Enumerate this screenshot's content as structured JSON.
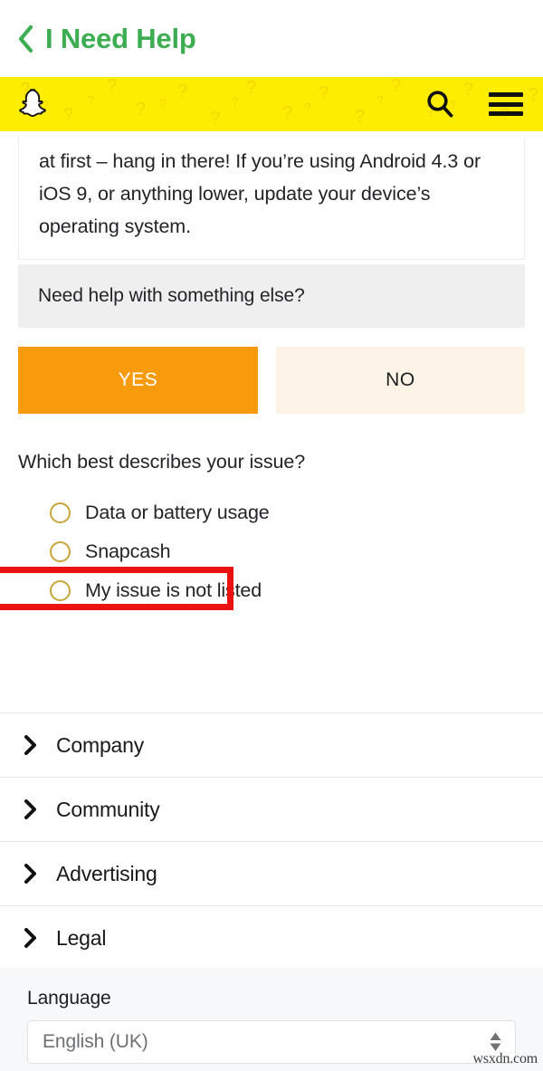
{
  "header": {
    "back_icon": "chevron-left-icon",
    "title": "I Need Help",
    "title_color": "#3cae51"
  },
  "snapbar": {
    "background_color": "#fded00",
    "logo_icon": "snapchat-ghost-icon",
    "search_icon": "search-icon",
    "menu_icon": "hamburger-menu-icon"
  },
  "answer": {
    "text": "at first – hang in there! If you’re using Android 4.3 or iOS 9, or anything lower, update your device’s operating system."
  },
  "need_help": {
    "text": "Need help with something else?",
    "background_color": "#efeff0"
  },
  "buttons": {
    "yes_label": "YES",
    "no_label": "NO",
    "yes_color": "#f79a0c",
    "no_color": "#fdf3e7"
  },
  "issue": {
    "question": "Which best describes your issue?",
    "options": [
      {
        "label": "Data or battery usage",
        "selected": false,
        "highlighted": false
      },
      {
        "label": "Snapcash",
        "selected": false,
        "highlighted": false
      },
      {
        "label": "My issue is not listed",
        "selected": false,
        "highlighted": true
      }
    ],
    "radio_border_color": "#c8a53a",
    "highlight_color": "#ed1212"
  },
  "accordion": {
    "chevron_icon": "chevron-right-icon",
    "items": [
      {
        "label": "Company"
      },
      {
        "label": "Community"
      },
      {
        "label": "Advertising"
      },
      {
        "label": "Legal"
      }
    ]
  },
  "language": {
    "label": "Language",
    "selected": "English (UK)",
    "stepper_icon": "stepper-up-down-icon"
  },
  "watermark": {
    "text": "wsxdn.com"
  }
}
